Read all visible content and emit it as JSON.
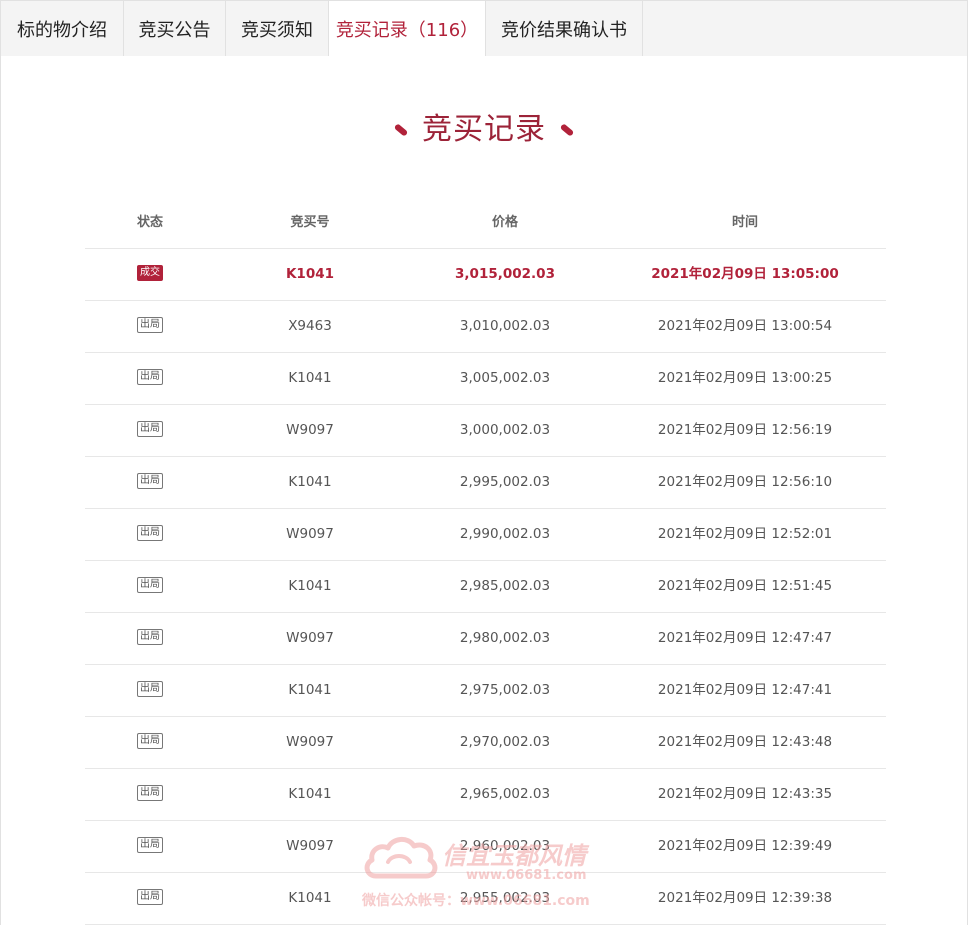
{
  "tabs": [
    {
      "label": "标的物介绍"
    },
    {
      "label": "竞买公告"
    },
    {
      "label": "竞买须知"
    },
    {
      "label": "竞买记录（116）"
    },
    {
      "label": "竞价结果确认书"
    }
  ],
  "section_title": "竞买记录",
  "table": {
    "headers": {
      "status": "状态",
      "bidder": "竞买号",
      "price": "价格",
      "time": "时间"
    },
    "rows": [
      {
        "status": "成交",
        "bidder": "K1041",
        "price": "3,015,002.03",
        "time": "2021年02月09日 13:05:00"
      },
      {
        "status": "出局",
        "bidder": "X9463",
        "price": "3,010,002.03",
        "time": "2021年02月09日 13:00:54"
      },
      {
        "status": "出局",
        "bidder": "K1041",
        "price": "3,005,002.03",
        "time": "2021年02月09日 13:00:25"
      },
      {
        "status": "出局",
        "bidder": "W9097",
        "price": "3,000,002.03",
        "time": "2021年02月09日 12:56:19"
      },
      {
        "status": "出局",
        "bidder": "K1041",
        "price": "2,995,002.03",
        "time": "2021年02月09日 12:56:10"
      },
      {
        "status": "出局",
        "bidder": "W9097",
        "price": "2,990,002.03",
        "time": "2021年02月09日 12:52:01"
      },
      {
        "status": "出局",
        "bidder": "K1041",
        "price": "2,985,002.03",
        "time": "2021年02月09日 12:51:45"
      },
      {
        "status": "出局",
        "bidder": "W9097",
        "price": "2,980,002.03",
        "time": "2021年02月09日 12:47:47"
      },
      {
        "status": "出局",
        "bidder": "K1041",
        "price": "2,975,002.03",
        "time": "2021年02月09日 12:47:41"
      },
      {
        "status": "出局",
        "bidder": "W9097",
        "price": "2,970,002.03",
        "time": "2021年02月09日 12:43:48"
      },
      {
        "status": "出局",
        "bidder": "K1041",
        "price": "2,965,002.03",
        "time": "2021年02月09日 12:43:35"
      },
      {
        "status": "出局",
        "bidder": "W9097",
        "price": "2,960,002.03",
        "time": "2021年02月09日 12:39:49"
      },
      {
        "status": "出局",
        "bidder": "K1041",
        "price": "2,955,002.03",
        "time": "2021年02月09日 12:39:38"
      }
    ]
  },
  "watermark": {
    "main": "信宜玉都风情",
    "url": "www.06681.com",
    "sub": "微信公众帐号：www.06681.com"
  },
  "colors": {
    "accent": "#b1223a",
    "tab_bg": "#f4f4f4",
    "border": "#e1e1e1"
  }
}
